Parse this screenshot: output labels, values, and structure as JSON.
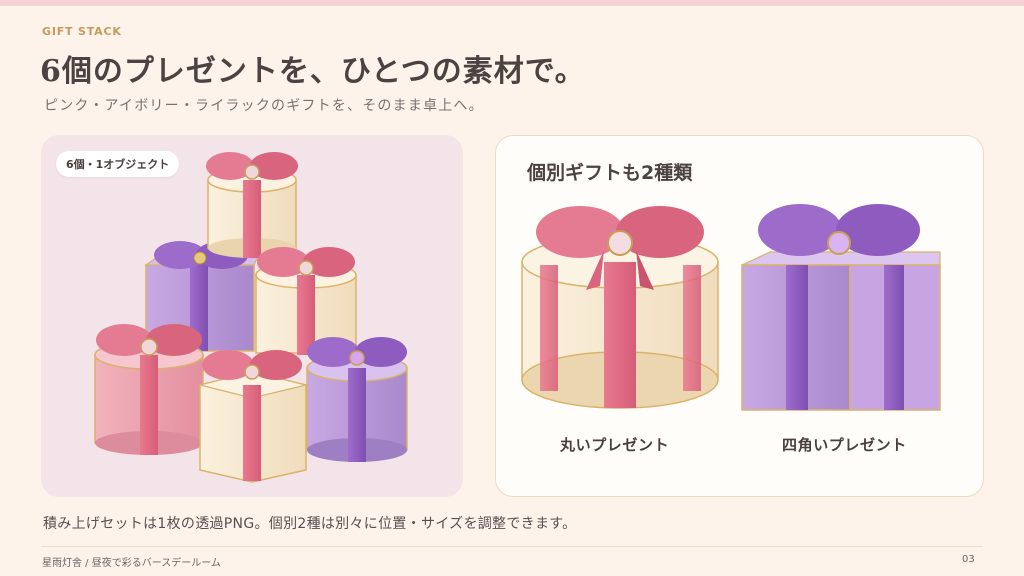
{
  "eyebrow": "GIFT STACK",
  "title": "6個のプレゼントを、ひとつの素材で。",
  "subtitle": "ピンク・アイボリー・ライラックのギフトを、そのまま卓上へ。",
  "left_panel": {
    "badge": "6個・1オブジェクト"
  },
  "right_panel": {
    "title": "個別ギフトも2種類",
    "items": [
      {
        "label": "丸いプレゼント",
        "icon": "round-gift-box-icon"
      },
      {
        "label": "四角いプレゼント",
        "icon": "square-gift-box-icon"
      }
    ]
  },
  "caption": "積み上げセットは1枚の透過PNG。個別2種は別々に位置・サイズを調整できます。",
  "footer": {
    "left": "星雨灯舎 / 昼夜で彩るバースデールーム",
    "page": "03"
  },
  "colors": {
    "background": "#fdf3ea",
    "accent_gold": "#c59a5a",
    "pink": "#e7889b",
    "ivory": "#f7e8cf",
    "lilac": "#b08ad0"
  }
}
